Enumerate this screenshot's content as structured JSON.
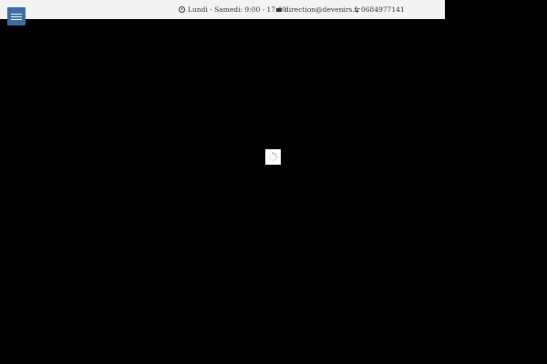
{
  "header": {
    "hours_text": "Lundi - Samedi: 9:00 - 17:00",
    "email_text": "direction@devenirs.fr",
    "phone_text": "0684977141",
    "icons": {
      "hours": "clock-icon",
      "email": "envelope-icon",
      "phone": "phone-icon",
      "menu": "hamburger-menu-icon"
    }
  },
  "colors": {
    "topbar_background": "#f3f3f3",
    "menu_button": "#3a6ea5",
    "page_background": "#000000",
    "loader_background": "#ffffff"
  },
  "loader": {
    "icon": "loading-spinner-icon"
  }
}
